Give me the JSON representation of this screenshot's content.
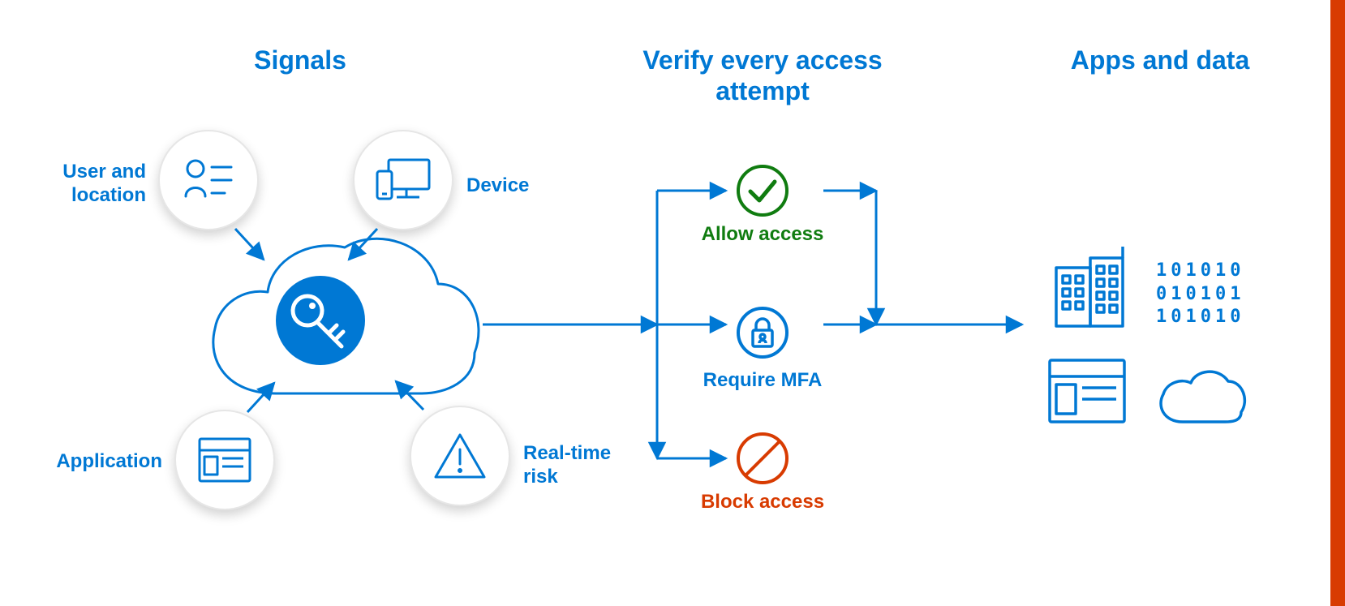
{
  "headings": {
    "signals": "Signals",
    "verify": "Verify every access attempt",
    "apps": "Apps and data"
  },
  "signals": {
    "user_location": "User and location",
    "device": "Device",
    "application": "Application",
    "realtime_risk": "Real-time risk"
  },
  "outcomes": {
    "allow": "Allow access",
    "mfa": "Require MFA",
    "block": "Block access"
  },
  "icons": {
    "user_location": "user-list-icon",
    "device": "device-icon",
    "application": "app-window-icon",
    "realtime_risk": "warning-triangle-icon",
    "cloud_key": "cloud-key-icon",
    "allow": "checkmark-circle-icon",
    "mfa": "lock-user-circle-icon",
    "block": "no-entry-icon",
    "building": "building-icon",
    "binary": "binary-data-icon",
    "app_window": "app-window-icon",
    "cloud": "cloud-icon"
  },
  "colors": {
    "primary": "#0078d4",
    "success": "#107c10",
    "danger": "#d83b01"
  },
  "binary_text": [
    "101010",
    "010101",
    "101010"
  ]
}
